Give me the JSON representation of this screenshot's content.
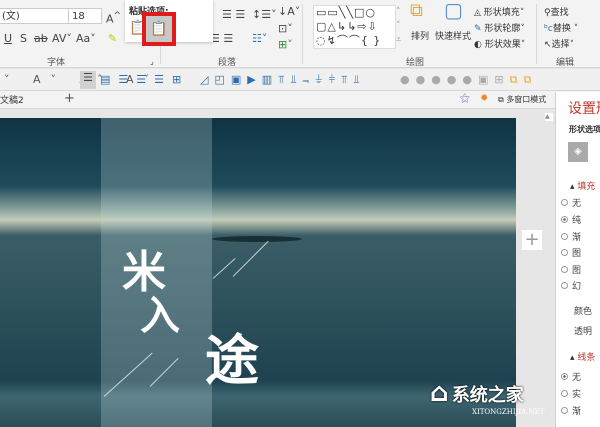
{
  "ribbon": {
    "font_name": "(文)",
    "font_size": "18",
    "font_group_label": "字体",
    "paragraph_group_label": "段落",
    "drawing_group_label": "绘图",
    "editing_group_label": "编辑",
    "paste_options_title": "粘贴选项:",
    "arrange_label": "排列",
    "quick_styles_label": "快速样式",
    "shape_fill": "形状填充",
    "shape_outline": "形状轮廓",
    "shape_effects": "形状效果",
    "find": "查找",
    "replace": "替换",
    "select": "选择"
  },
  "tabs": {
    "doc_tab": "文稿2",
    "add_tab": "+",
    "multi_window": "多窗口模式"
  },
  "slide": {
    "char1": "米",
    "char2": "入",
    "char3": "途"
  },
  "panel": {
    "title": "设置形",
    "shape_options": "形状选项",
    "fill_section": "填充",
    "fill_options": [
      "无",
      "纯",
      "渐",
      "图",
      "图",
      "幻"
    ],
    "color_label": "颜色",
    "transparency_label": "透明",
    "line_section": "线条",
    "line_options": [
      "无",
      "实",
      "渐"
    ]
  },
  "watermark": {
    "text": "系统之家",
    "url": "XITONGZHIJIA.NET"
  },
  "colors": {
    "accent": "#c0392b",
    "highlight": "#e01b1b"
  }
}
